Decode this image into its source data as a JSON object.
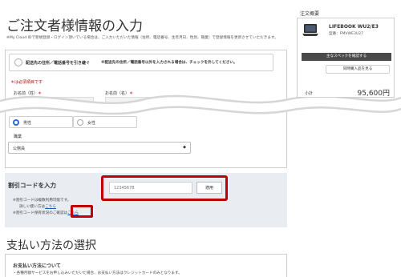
{
  "page": {
    "title": "ご注文者様情報の入力",
    "intro": "※My Cloud IDで新規登録・ログイン頂いている場合は、ご入力いただいた情報（住所、電話番号、生年月日、性別、職業）で登録情報を更新させていただきます。"
  },
  "form": {
    "checkbox_label": "配送先の住所／電話番号を引き継ぐ",
    "checkbox_note": "※配送先の住所／電話番号以外を入力される場合は、チェックを外してください。",
    "required_note": "＊は必須項目です",
    "last_name_label": "お名前（姓）",
    "first_name_label": "お名前（名）",
    "required_mark": "＊",
    "gender_male": "男性",
    "gender_female": "女性",
    "occupation_label": "職業",
    "occupation_value": "公務員",
    "occupation_arrow": "◆"
  },
  "coupon": {
    "title": "割引コードを入力",
    "placeholder": "12345678",
    "apply": "適用",
    "note1": "※割引コードは複数利用可能です。",
    "note2_prefix": "詳しい使い方は",
    "note3_prefix": "※割引コード保有状況のご確認は",
    "link": "こちら"
  },
  "payment": {
    "title": "支払い方法の選択",
    "subtitle": "お支払い方法について",
    "note": "・各種月額サービスをお申し込みいただいた場合、お支払い方法はクレジットカードのみとなります。"
  },
  "sidebar": {
    "title": "注文概要",
    "product_name": "LIFEBOOK WU2/E3",
    "product_model": "型番：FMVWE3U27",
    "spec_button": "主なスペックを確認する",
    "link": "同時購入品を見る",
    "subtotal_label": "小計",
    "subtotal_value": "95,600円"
  },
  "colors": {
    "highlight": "#c00000",
    "accent": "#2d6ad0",
    "link": "#1a5fb4"
  }
}
